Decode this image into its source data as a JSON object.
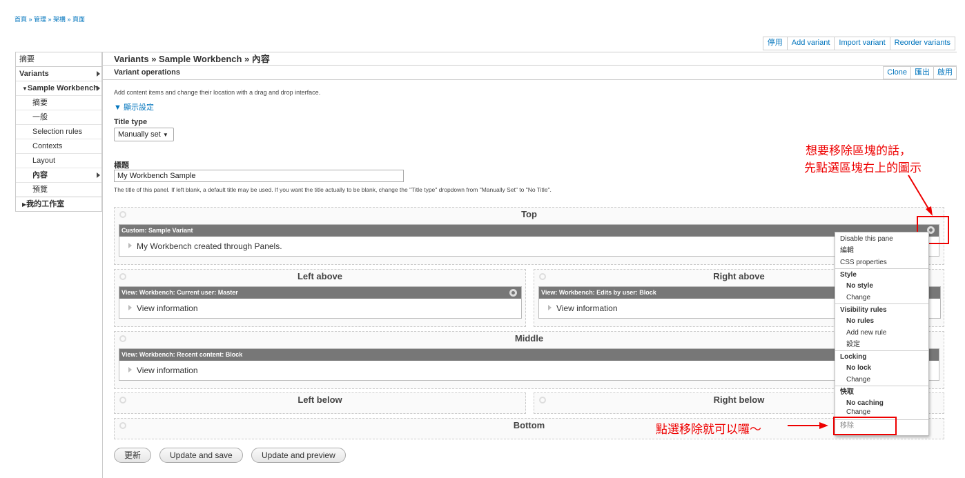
{
  "breadcrumb": "首頁 » 管理 » 架構 » 頁面",
  "top_tabs": [
    "停用",
    "Add variant",
    "Import variant",
    "Reorder variants"
  ],
  "sidebar": {
    "summary": "摘要",
    "variants": "Variants",
    "workbench": "Sample Workbench",
    "items": [
      "摘要",
      "一般",
      "Selection rules",
      "Contexts",
      "Layout",
      "內容",
      "預覽"
    ],
    "my_workspace": "我的工作室"
  },
  "main": {
    "title": "Variants » Sample Workbench » 內容",
    "ops_label": "Variant operations",
    "ops_actions": [
      "Clone",
      "匯出",
      "啟用"
    ],
    "description": "Add content items and change their location with a drag and drop interface.",
    "display_settings": "▼ 顯示設定",
    "title_type_label": "Title type",
    "title_type_value": "Manually set",
    "title_label": "標題",
    "title_value": "My Workbench Sample",
    "title_help": "The title of this panel. If left blank, a default title may be used. If you want the title actually to be blank, change the \"Title type\" dropdown from \"Manually Set\" to \"No Title\"."
  },
  "regions": {
    "top": "Top",
    "left_above": "Left above",
    "right_above": "Right above",
    "middle": "Middle",
    "left_below": "Left below",
    "right_below": "Right below",
    "bottom": "Bottom"
  },
  "panes": {
    "top": {
      "title": "Custom: Sample Variant",
      "body": "My Workbench created through Panels."
    },
    "left_above": {
      "title": "View: Workbench: Current user: Master",
      "body": "View information"
    },
    "right_above": {
      "title": "View: Workbench: Edits by user: Block",
      "body": "View information"
    },
    "middle": {
      "title": "View: Workbench: Recent content: Block",
      "body": "View information"
    }
  },
  "buttons": {
    "update": "更新",
    "update_save": "Update and save",
    "update_preview": "Update and preview"
  },
  "menu": {
    "disable": "Disable this pane",
    "edit": "編輯",
    "css": "CSS properties",
    "style_head": "Style",
    "style_cur": "No style",
    "style_change": "Change",
    "vis_head": "Visibility rules",
    "vis_cur": "No rules",
    "vis_add": "Add new rule",
    "vis_settings": "設定",
    "lock_head": "Locking",
    "lock_cur": "No lock",
    "lock_change": "Change",
    "cache_head": "快取",
    "cache_cur": "No caching",
    "cache_change": "Change",
    "remove": "移除"
  },
  "annotations": {
    "line1": "想要移除區塊的話，",
    "line2": "先點選區塊右上的圖示",
    "remove_hint": "點選移除就可以囉～"
  },
  "colors": {
    "link": "#0074bd",
    "pane_header": "#777777",
    "annotation": "#ee0000"
  }
}
